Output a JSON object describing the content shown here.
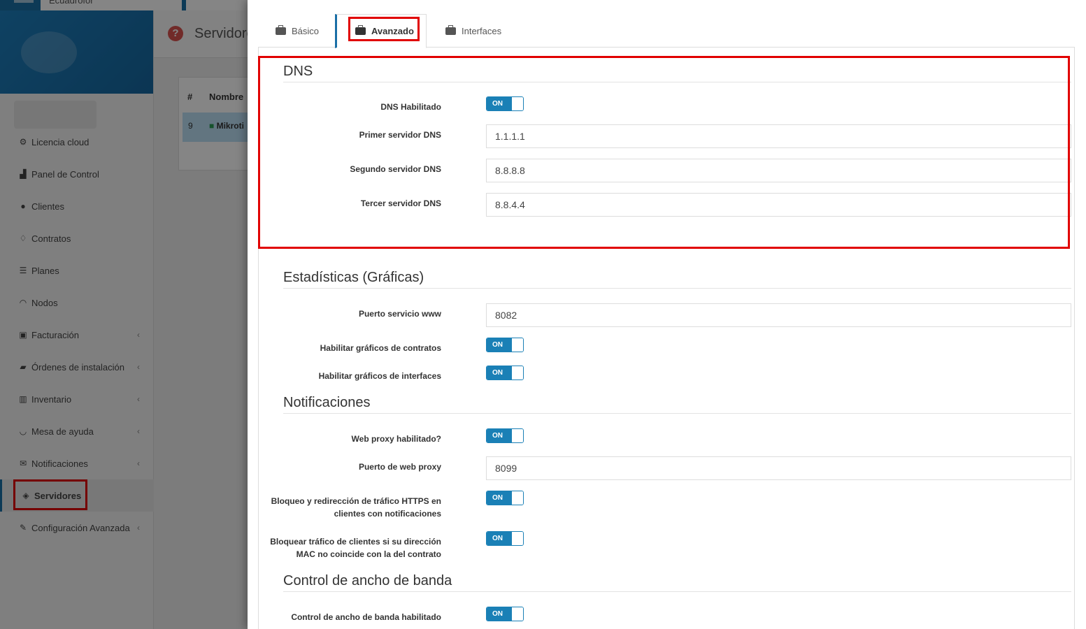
{
  "topbar": {
    "field_text": "Ecuadrofor"
  },
  "sidebar": {
    "items": [
      {
        "label": "Licencia cloud",
        "icon": "user-cog-icon",
        "glyph": "⚙",
        "chevron": ""
      },
      {
        "label": "Panel de Control",
        "icon": "chart-area-icon",
        "glyph": "▟",
        "chevron": ""
      },
      {
        "label": "Clientes",
        "icon": "users-icon",
        "glyph": "●",
        "chevron": ""
      },
      {
        "label": "Contratos",
        "icon": "handshake-icon",
        "glyph": "♢",
        "chevron": ""
      },
      {
        "label": "Planes",
        "icon": "list-icon",
        "glyph": "☰",
        "chevron": ""
      },
      {
        "label": "Nodos",
        "icon": "wifi-icon",
        "glyph": "◠",
        "chevron": ""
      },
      {
        "label": "Facturación",
        "icon": "money-icon",
        "glyph": "▣",
        "chevron": "‹"
      },
      {
        "label": "Órdenes de instalación",
        "icon": "truck-icon",
        "glyph": "▰",
        "chevron": "‹"
      },
      {
        "label": "Inventario",
        "icon": "barcode-icon",
        "glyph": "▥",
        "chevron": "‹"
      },
      {
        "label": "Mesa de ayuda",
        "icon": "headset-icon",
        "glyph": "◡",
        "chevron": "‹"
      },
      {
        "label": "Notificaciones",
        "icon": "envelope-icon",
        "glyph": "✉",
        "chevron": "‹"
      },
      {
        "label": "Servidores",
        "icon": "cube-icon",
        "glyph": "◈",
        "chevron": ""
      },
      {
        "label": "Configuración Avanzada",
        "icon": "wrench-icon",
        "glyph": "✎",
        "chevron": "‹"
      }
    ]
  },
  "main": {
    "title": "Servidore",
    "help_glyph": "?",
    "table": {
      "col_hash": "#",
      "col_name": "Nombre",
      "row_id": "9",
      "row_name": "Mikroti"
    }
  },
  "modal": {
    "tabs": [
      {
        "label": "Básico"
      },
      {
        "label": "Avanzado"
      },
      {
        "label": "Interfaces"
      }
    ],
    "dns": {
      "title": "DNS",
      "enabled_label": "DNS Habilitado",
      "enabled_state": "ON",
      "primary_label": "Primer servidor DNS",
      "primary_value": "1.1.1.1",
      "secondary_label": "Segundo servidor DNS",
      "secondary_value": "8.8.8.8",
      "tertiary_label": "Tercer servidor DNS",
      "tertiary_value": "8.8.4.4"
    },
    "stats": {
      "title": "Estadísticas (Gráficas)",
      "www_port_label": "Puerto servicio www",
      "www_port_value": "8082",
      "contracts_label": "Habilitar gráficos de contratos",
      "contracts_state": "ON",
      "interfaces_label": "Habilitar gráficos de interfaces",
      "interfaces_state": "ON"
    },
    "notifications": {
      "title": "Notificaciones",
      "proxy_enabled_label": "Web proxy habilitado?",
      "proxy_enabled_state": "ON",
      "proxy_port_label": "Puerto de web proxy",
      "proxy_port_value": "8099",
      "https_block_label_1": "Bloqueo y redirección de tráfico HTTPS en",
      "https_block_label_2": "clientes con notificaciones",
      "https_block_state": "ON",
      "mac_block_label_1": "Bloquear tráfico de clientes si su dirección",
      "mac_block_label_2": "MAC no coincide con la del contrato",
      "mac_block_state": "ON"
    },
    "bandwidth": {
      "title": "Control de ancho de banda",
      "enabled_label": "Control de ancho de banda habilitado",
      "enabled_state": "ON"
    }
  },
  "highlight_color": "#e10000",
  "accent_color": "#1a80b6"
}
